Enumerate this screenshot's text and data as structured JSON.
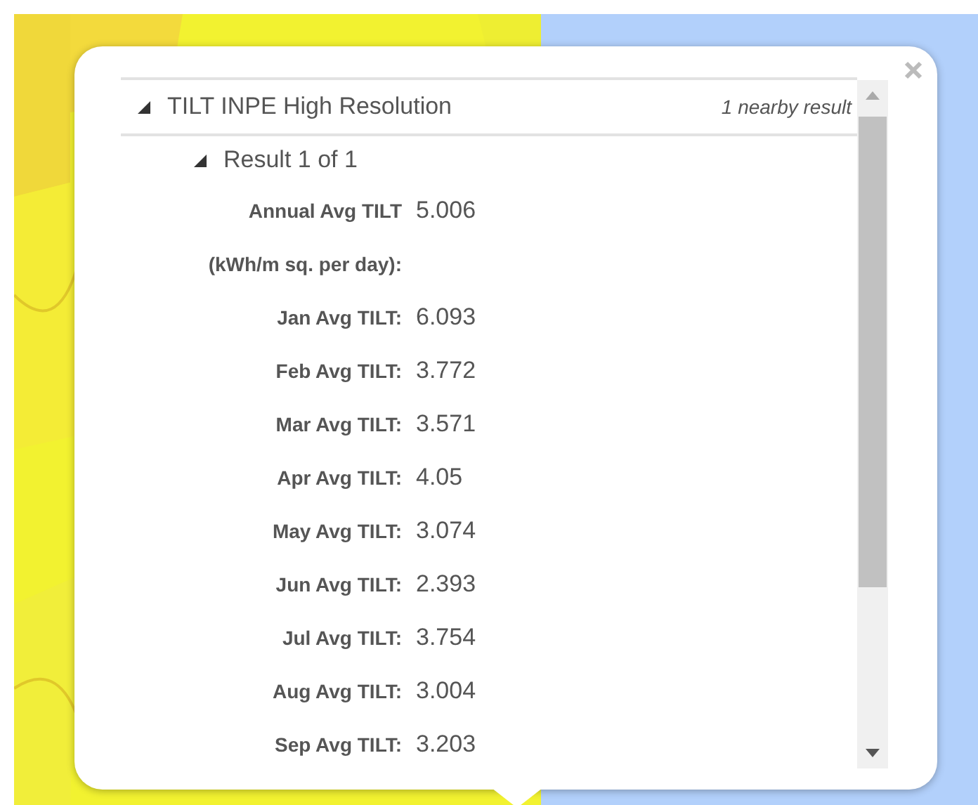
{
  "popup": {
    "layer": {
      "title": "TILT INPE High Resolution",
      "expanded": true,
      "count": "1 nearby result"
    },
    "result": {
      "title": "Result 1 of 1",
      "expanded": true
    },
    "fields": [
      {
        "label": "Annual Avg TILT (kWh/m sq. per day):",
        "value": "5.006"
      },
      {
        "label": "Jan Avg TILT:",
        "value": "6.093"
      },
      {
        "label": "Feb Avg TILT:",
        "value": "3.772"
      },
      {
        "label": "Mar Avg TILT:",
        "value": "3.571"
      },
      {
        "label": "Apr Avg TILT:",
        "value": "4.05"
      },
      {
        "label": "May Avg TILT:",
        "value": "3.074"
      },
      {
        "label": "Jun Avg TILT:",
        "value": "2.393"
      },
      {
        "label": "Jul Avg TILT:",
        "value": "3.754"
      },
      {
        "label": "Aug Avg TILT:",
        "value": "3.004"
      },
      {
        "label": "Sep Avg TILT:",
        "value": "3.203"
      }
    ]
  }
}
